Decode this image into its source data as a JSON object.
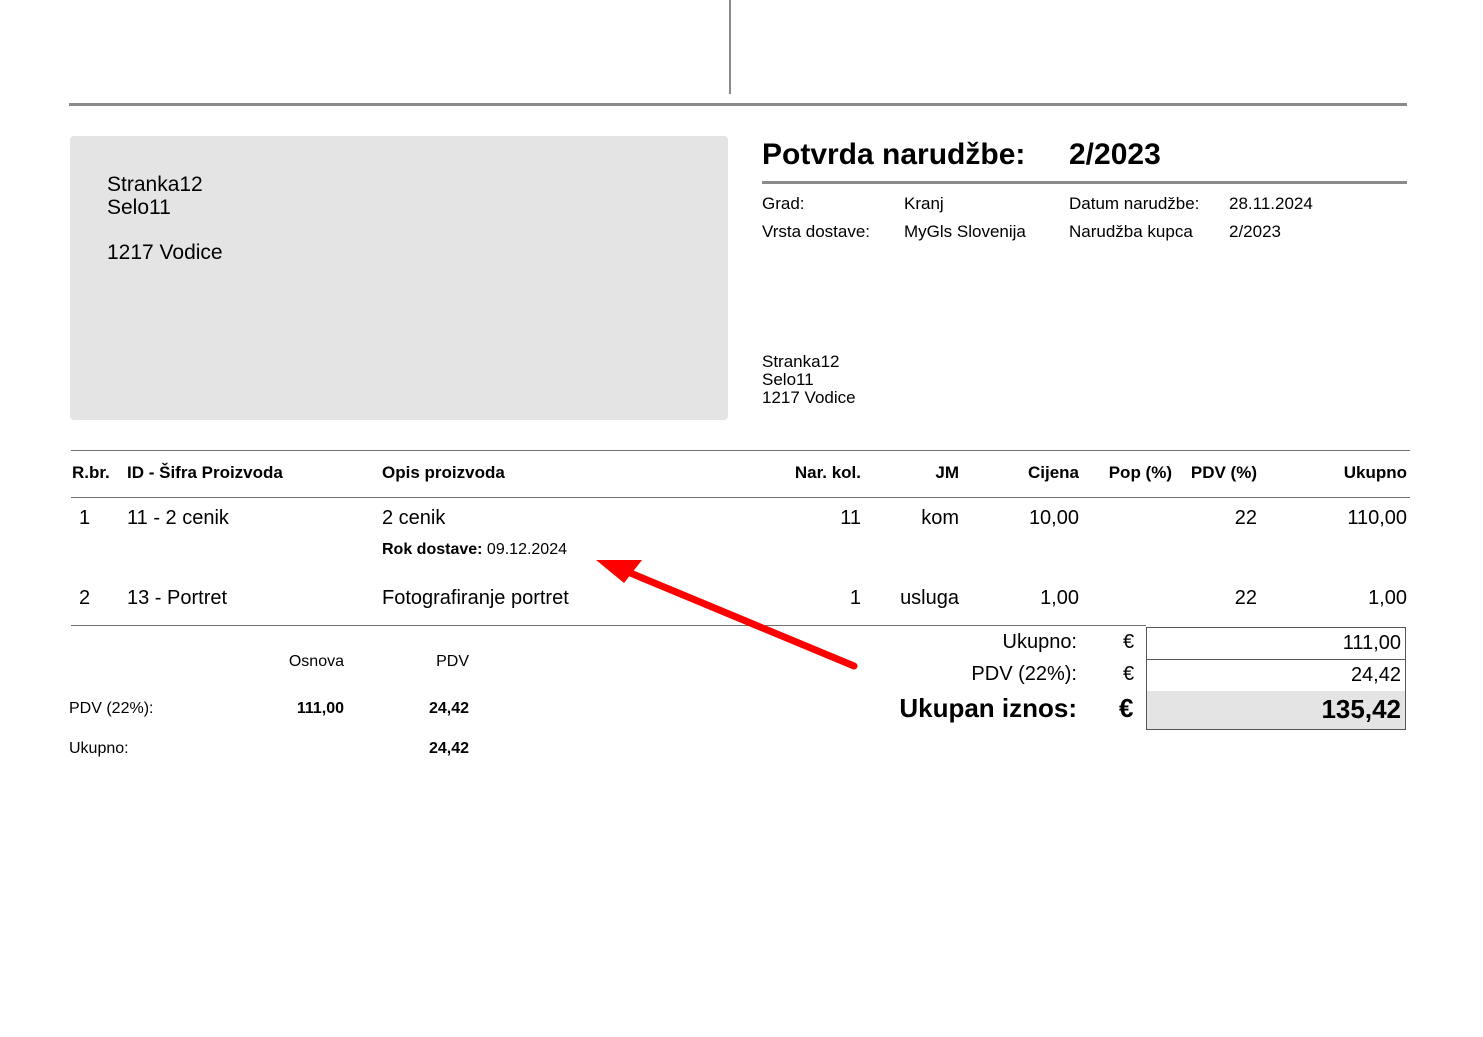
{
  "recipient": {
    "name": "Stranka12",
    "street": "Selo11",
    "city": "1217 Vodice"
  },
  "title": {
    "label": "Potvrda narudžbe:",
    "number": "2/2023"
  },
  "meta": {
    "city_label": "Grad:",
    "city_value": "Kranj",
    "order_date_label": "Datum narudžbe:",
    "order_date_value": "28.11.2024",
    "delivery_type_label": "Vrsta dostave:",
    "delivery_type_value": "MyGls Slovenija",
    "customer_order_label": "Narudžba kupca",
    "customer_order_value": "2/2023"
  },
  "shipping": {
    "name": "Stranka12",
    "street": "Selo11",
    "city": "1217 Vodice"
  },
  "table": {
    "headers": [
      "R.br.",
      "ID - Šifra Proizvoda",
      "Opis proizvoda",
      "Nar. kol.",
      "JM",
      "Cijena",
      "Pop (%)",
      "PDV (%)",
      "Ukupno"
    ],
    "rows": [
      {
        "no": "1",
        "id": "11 - 2 cenik",
        "desc": "2 cenik",
        "qty": "11",
        "unit": "kom",
        "price": "10,00",
        "discount": "",
        "vat": "22",
        "total": "110,00",
        "note_label": "Rok dostave:",
        "note_value": "09.12.2024"
      },
      {
        "no": "2",
        "id": "13 - Portret",
        "desc": "Fotografiranje portret",
        "qty": "1",
        "unit": "usluga",
        "price": "1,00",
        "discount": "",
        "vat": "22",
        "total": "1,00"
      }
    ]
  },
  "vat_summary": {
    "base_header": "Osnova",
    "vat_header": "PDV",
    "row_label": "PDV (22%):",
    "row_base": "111,00",
    "row_vat": "24,42",
    "total_label": "Ukupno:",
    "total_vat": "24,42"
  },
  "totals": {
    "subtotal_label": "Ukupno:",
    "vat_label": "PDV (22%):",
    "grand_label": "Ukupan iznos:",
    "currency": "€",
    "subtotal": "111,00",
    "vat": "24,42",
    "grand": "135,42"
  },
  "colors": {
    "arrow": "#ff0000",
    "box_fill": "#e4e4e4",
    "rule": "#8a8a8a"
  }
}
